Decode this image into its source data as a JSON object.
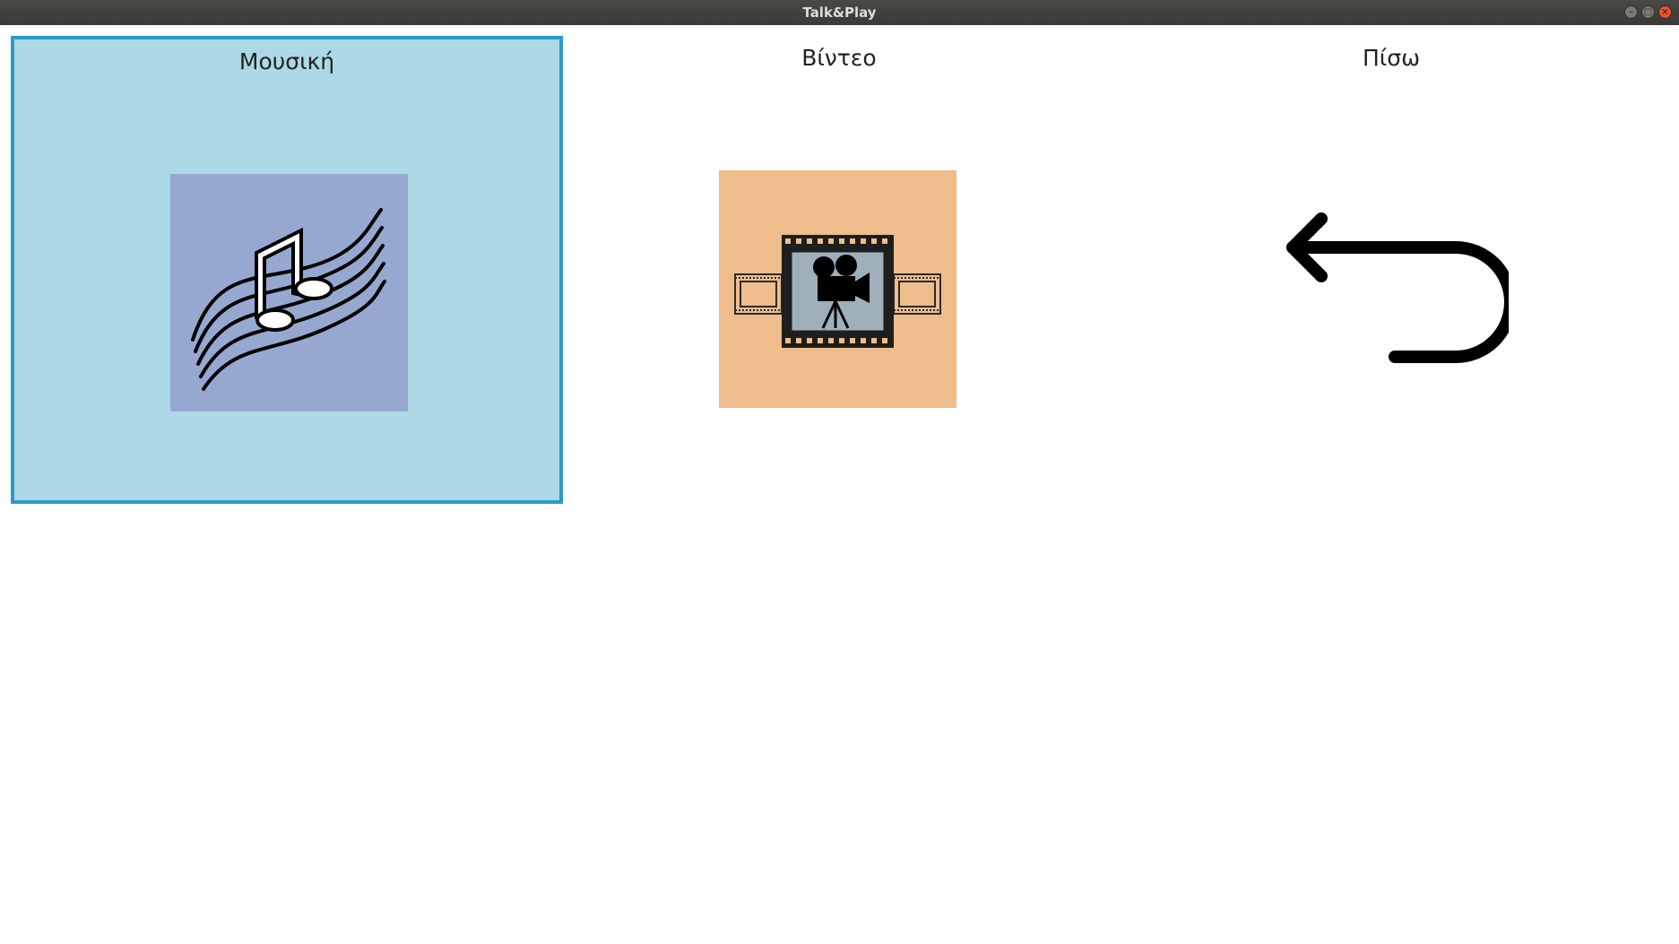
{
  "window": {
    "title": "Talk&Play",
    "controls": {
      "minimize": "–",
      "maximize": "□",
      "close": "×"
    }
  },
  "tiles": [
    {
      "label": "Μουσική",
      "icon": "music-notes-icon",
      "selected": true,
      "bg": "#97a8d0"
    },
    {
      "label": "Βίντεο",
      "icon": "movie-camera-icon",
      "selected": false,
      "bg": "#eebd8b"
    },
    {
      "label": "Πίσω",
      "icon": "back-arrow-icon",
      "selected": false
    }
  ],
  "colors": {
    "selected_fill": "#add8e6",
    "selected_border": "#2a9cc7",
    "music_bg": "#97a8d0",
    "video_bg": "#eebd8b"
  }
}
